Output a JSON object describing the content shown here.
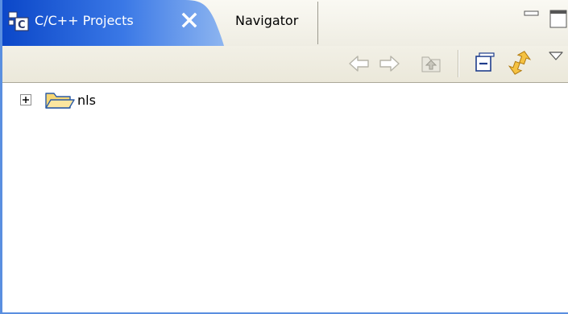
{
  "tabs": {
    "active": {
      "label": "C/C++ Projects",
      "icon": "cpp-projects-icon"
    },
    "inactive": {
      "label": "Navigator"
    }
  },
  "window_controls": {
    "minimize": "minimize-icon",
    "maximize": "maximize-icon"
  },
  "toolbar": {
    "items": [
      "back-icon",
      "forward-icon",
      "up-icon",
      "collapse-all-icon",
      "link-with-editor-icon",
      "view-menu-icon"
    ]
  },
  "tree": {
    "items": [
      {
        "label": "nls",
        "icon": "folder-open-icon",
        "expander": "plus"
      }
    ]
  },
  "colors": {
    "active_tab_start": "#0a46c8",
    "active_tab_end": "#7aa7ee",
    "border_accent": "#5a8fe0",
    "tab_background": "#f3f1e8"
  }
}
